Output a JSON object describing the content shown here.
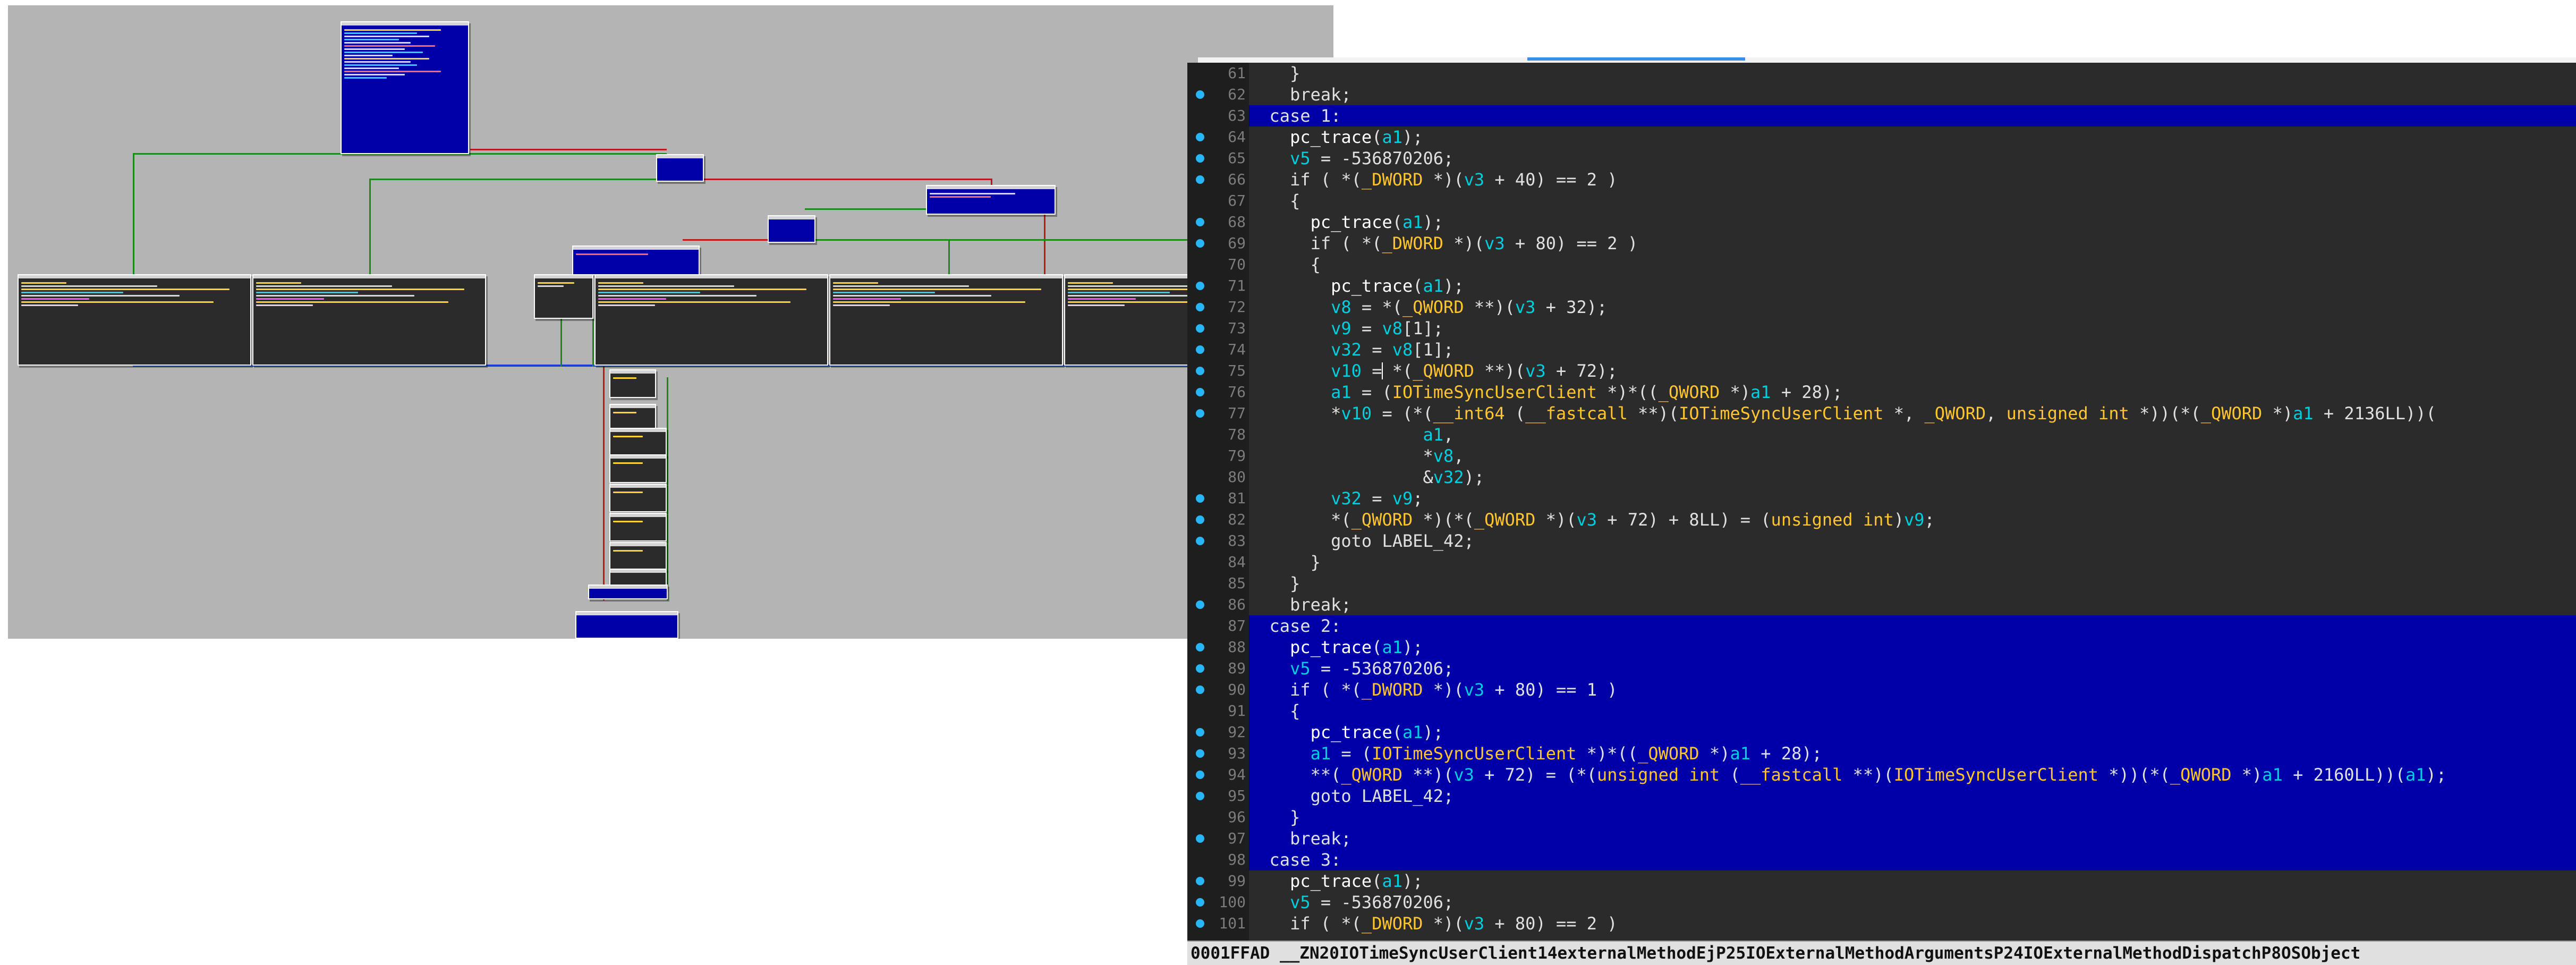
{
  "graph_view": {
    "label": "function-graph-overview"
  },
  "pseudocode": {
    "status_bar_text": "0001FFAD __ZN20IOTimeSyncUserClient14externalMethodEjP25IOExternalMethodArgumentsP24IOExternalMethodDispatchP8OSObject",
    "colors": {
      "highlight": "#0000a8",
      "variable": "#00cfe0",
      "type": "#ffc42e",
      "function": "#ffffff",
      "default": "#d4d4d4",
      "breakpoint_dot": "#29b6f6"
    },
    "lines": [
      {
        "n": "61",
        "dot": false,
        "hl": false,
        "tokens": [
          [
            "d",
            "    }"
          ]
        ]
      },
      {
        "n": "62",
        "dot": true,
        "hl": false,
        "tokens": [
          [
            "d",
            "    break;"
          ]
        ]
      },
      {
        "n": "63",
        "dot": false,
        "hl": true,
        "tokens": [
          [
            "d",
            "  case 1:"
          ]
        ]
      },
      {
        "n": "64",
        "dot": true,
        "hl": false,
        "tokens": [
          [
            "d",
            "    "
          ],
          [
            "f",
            "pc_trace"
          ],
          [
            "d",
            "("
          ],
          [
            "v",
            "a1"
          ],
          [
            "d",
            ");"
          ]
        ]
      },
      {
        "n": "65",
        "dot": true,
        "hl": false,
        "tokens": [
          [
            "d",
            "    "
          ],
          [
            "v",
            "v5"
          ],
          [
            "d",
            " = -536870206;"
          ]
        ]
      },
      {
        "n": "66",
        "dot": true,
        "hl": false,
        "tokens": [
          [
            "d",
            "    if ( *("
          ],
          [
            "t",
            "_DWORD"
          ],
          [
            "d",
            " *)("
          ],
          [
            "v",
            "v3"
          ],
          [
            "d",
            " + 40) == 2 )"
          ]
        ]
      },
      {
        "n": "67",
        "dot": false,
        "hl": false,
        "tokens": [
          [
            "d",
            "    {"
          ]
        ]
      },
      {
        "n": "68",
        "dot": true,
        "hl": false,
        "tokens": [
          [
            "d",
            "      "
          ],
          [
            "f",
            "pc_trace"
          ],
          [
            "d",
            "("
          ],
          [
            "v",
            "a1"
          ],
          [
            "d",
            ");"
          ]
        ]
      },
      {
        "n": "69",
        "dot": true,
        "hl": false,
        "tokens": [
          [
            "d",
            "      if ( *("
          ],
          [
            "t",
            "_DWORD"
          ],
          [
            "d",
            " *)("
          ],
          [
            "v",
            "v3"
          ],
          [
            "d",
            " + 80) == 2 )"
          ]
        ]
      },
      {
        "n": "70",
        "dot": false,
        "hl": false,
        "tokens": [
          [
            "d",
            "      {"
          ]
        ]
      },
      {
        "n": "71",
        "dot": true,
        "hl": false,
        "tokens": [
          [
            "d",
            "        "
          ],
          [
            "f",
            "pc_trace"
          ],
          [
            "d",
            "("
          ],
          [
            "v",
            "a1"
          ],
          [
            "d",
            ");"
          ]
        ]
      },
      {
        "n": "72",
        "dot": true,
        "hl": false,
        "tokens": [
          [
            "d",
            "        "
          ],
          [
            "v",
            "v8"
          ],
          [
            "d",
            " = *("
          ],
          [
            "t",
            "_QWORD"
          ],
          [
            "d",
            " **)("
          ],
          [
            "v",
            "v3"
          ],
          [
            "d",
            " + 32);"
          ]
        ]
      },
      {
        "n": "73",
        "dot": true,
        "hl": false,
        "tokens": [
          [
            "d",
            "        "
          ],
          [
            "v",
            "v9"
          ],
          [
            "d",
            " = "
          ],
          [
            "v",
            "v8"
          ],
          [
            "d",
            "[1];"
          ]
        ]
      },
      {
        "n": "74",
        "dot": true,
        "hl": false,
        "tokens": [
          [
            "d",
            "        "
          ],
          [
            "v",
            "v32"
          ],
          [
            "d",
            " = "
          ],
          [
            "v",
            "v8"
          ],
          [
            "d",
            "[1];"
          ]
        ]
      },
      {
        "n": "75",
        "dot": true,
        "hl": false,
        "tokens": [
          [
            "d",
            "        "
          ],
          [
            "v",
            "v10"
          ],
          [
            "d",
            " = *("
          ],
          [
            "t",
            "_QWORD"
          ],
          [
            "d",
            " **)("
          ],
          [
            "v",
            "v3"
          ],
          [
            "d",
            " + 72);"
          ]
        ]
      },
      {
        "n": "76",
        "dot": true,
        "hl": false,
        "tokens": [
          [
            "d",
            "        "
          ],
          [
            "v",
            "a1"
          ],
          [
            "d",
            " = ("
          ],
          [
            "t",
            "IOTimeSyncUserClient"
          ],
          [
            "d",
            " *)*(("
          ],
          [
            "t",
            "_QWORD"
          ],
          [
            "d",
            " *)"
          ],
          [
            "v",
            "a1"
          ],
          [
            "d",
            " + 28);"
          ]
        ]
      },
      {
        "n": "77",
        "dot": true,
        "hl": false,
        "tokens": [
          [
            "d",
            "        *"
          ],
          [
            "v",
            "v10"
          ],
          [
            "d",
            " = (*("
          ],
          [
            "t",
            "__int64"
          ],
          [
            "d",
            " ("
          ],
          [
            "t",
            "__fastcall"
          ],
          [
            "d",
            " **)("
          ],
          [
            "t",
            "IOTimeSyncUserClient"
          ],
          [
            "d",
            " *, "
          ],
          [
            "t",
            "_QWORD"
          ],
          [
            "d",
            ", "
          ],
          [
            "t",
            "unsigned int"
          ],
          [
            "d",
            " *))(*("
          ],
          [
            "t",
            "_QWORD"
          ],
          [
            "d",
            " *)"
          ],
          [
            "v",
            "a1"
          ],
          [
            "d",
            " + 2136LL))("
          ]
        ]
      },
      {
        "n": "78",
        "dot": false,
        "hl": false,
        "tokens": [
          [
            "d",
            "                 "
          ],
          [
            "v",
            "a1"
          ],
          [
            "d",
            ","
          ]
        ]
      },
      {
        "n": "79",
        "dot": false,
        "hl": false,
        "tokens": [
          [
            "d",
            "                 *"
          ],
          [
            "v",
            "v8"
          ],
          [
            "d",
            ","
          ]
        ]
      },
      {
        "n": "80",
        "dot": false,
        "hl": false,
        "tokens": [
          [
            "d",
            "                 &"
          ],
          [
            "v",
            "v32"
          ],
          [
            "d",
            ");"
          ]
        ]
      },
      {
        "n": "81",
        "dot": true,
        "hl": false,
        "tokens": [
          [
            "d",
            "        "
          ],
          [
            "v",
            "v32"
          ],
          [
            "d",
            " = "
          ],
          [
            "v",
            "v9"
          ],
          [
            "d",
            ";"
          ]
        ]
      },
      {
        "n": "82",
        "dot": true,
        "hl": false,
        "tokens": [
          [
            "d",
            "        *("
          ],
          [
            "t",
            "_QWORD"
          ],
          [
            "d",
            " *)(*("
          ],
          [
            "t",
            "_QWORD"
          ],
          [
            "d",
            " *)("
          ],
          [
            "v",
            "v3"
          ],
          [
            "d",
            " + 72) + 8LL) = ("
          ],
          [
            "t",
            "unsigned int"
          ],
          [
            "d",
            ")"
          ],
          [
            "v",
            "v9"
          ],
          [
            "d",
            ";"
          ]
        ]
      },
      {
        "n": "83",
        "dot": true,
        "hl": false,
        "tokens": [
          [
            "d",
            "        goto LABEL_42;"
          ]
        ]
      },
      {
        "n": "84",
        "dot": false,
        "hl": false,
        "tokens": [
          [
            "d",
            "      }"
          ]
        ]
      },
      {
        "n": "85",
        "dot": false,
        "hl": false,
        "tokens": [
          [
            "d",
            "    }"
          ]
        ]
      },
      {
        "n": "86",
        "dot": true,
        "hl": false,
        "tokens": [
          [
            "d",
            "    break;"
          ]
        ]
      },
      {
        "n": "87",
        "dot": false,
        "hl": true,
        "tokens": [
          [
            "d",
            "  case 2:"
          ]
        ]
      },
      {
        "n": "88",
        "dot": true,
        "hl": true,
        "tokens": [
          [
            "d",
            "    "
          ],
          [
            "f",
            "pc_trace"
          ],
          [
            "d",
            "("
          ],
          [
            "v",
            "a1"
          ],
          [
            "d",
            ");"
          ]
        ]
      },
      {
        "n": "89",
        "dot": true,
        "hl": true,
        "tokens": [
          [
            "d",
            "    "
          ],
          [
            "v",
            "v5"
          ],
          [
            "d",
            " = -536870206;"
          ]
        ]
      },
      {
        "n": "90",
        "dot": true,
        "hl": true,
        "tokens": [
          [
            "d",
            "    if ( *("
          ],
          [
            "t",
            "_DWORD"
          ],
          [
            "d",
            " *)("
          ],
          [
            "v",
            "v3"
          ],
          [
            "d",
            " + 80) == 1 )"
          ]
        ]
      },
      {
        "n": "91",
        "dot": false,
        "hl": true,
        "tokens": [
          [
            "d",
            "    {"
          ]
        ]
      },
      {
        "n": "92",
        "dot": true,
        "hl": true,
        "tokens": [
          [
            "d",
            "      "
          ],
          [
            "f",
            "pc_trace"
          ],
          [
            "d",
            "("
          ],
          [
            "v",
            "a1"
          ],
          [
            "d",
            ");"
          ]
        ]
      },
      {
        "n": "93",
        "dot": true,
        "hl": true,
        "tokens": [
          [
            "d",
            "      "
          ],
          [
            "v",
            "a1"
          ],
          [
            "d",
            " = ("
          ],
          [
            "t",
            "IOTimeSyncUserClient"
          ],
          [
            "d",
            " *)*(("
          ],
          [
            "t",
            "_QWORD"
          ],
          [
            "d",
            " *)"
          ],
          [
            "v",
            "a1"
          ],
          [
            "d",
            " + 28);"
          ]
        ]
      },
      {
        "n": "94",
        "dot": true,
        "hl": true,
        "tokens": [
          [
            "d",
            "      **("
          ],
          [
            "t",
            "_QWORD"
          ],
          [
            "d",
            " **)("
          ],
          [
            "v",
            "v3"
          ],
          [
            "d",
            " + 72) = (*("
          ],
          [
            "t",
            "unsigned int"
          ],
          [
            "d",
            " ("
          ],
          [
            "t",
            "__fastcall"
          ],
          [
            "d",
            " **)("
          ],
          [
            "t",
            "IOTimeSyncUserClient"
          ],
          [
            "d",
            " *))(*("
          ],
          [
            "t",
            "_QWORD"
          ],
          [
            "d",
            " *)"
          ],
          [
            "v",
            "a1"
          ],
          [
            "d",
            " + 2160LL))("
          ],
          [
            "v",
            "a1"
          ],
          [
            "d",
            ");"
          ]
        ]
      },
      {
        "n": "95",
        "dot": true,
        "hl": true,
        "tokens": [
          [
            "d",
            "      goto LABEL_42;"
          ]
        ]
      },
      {
        "n": "96",
        "dot": false,
        "hl": true,
        "tokens": [
          [
            "d",
            "    }"
          ]
        ]
      },
      {
        "n": "97",
        "dot": true,
        "hl": true,
        "tokens": [
          [
            "d",
            "    break;"
          ]
        ]
      },
      {
        "n": "98",
        "dot": false,
        "hl": true,
        "tokens": [
          [
            "d",
            "  case 3:"
          ]
        ]
      },
      {
        "n": "99",
        "dot": true,
        "hl": false,
        "tokens": [
          [
            "d",
            "    "
          ],
          [
            "f",
            "pc_trace"
          ],
          [
            "d",
            "("
          ],
          [
            "v",
            "a1"
          ],
          [
            "d",
            ");"
          ]
        ]
      },
      {
        "n": "100",
        "dot": true,
        "hl": false,
        "tokens": [
          [
            "d",
            "    "
          ],
          [
            "v",
            "v5"
          ],
          [
            "d",
            " = -536870206;"
          ]
        ]
      },
      {
        "n": "101",
        "dot": true,
        "hl": false,
        "tokens": [
          [
            "d",
            "    if ( *("
          ],
          [
            "t",
            "_DWORD"
          ],
          [
            "d",
            " *)("
          ],
          [
            "v",
            "v3"
          ],
          [
            "d",
            " + 80) == 2 )"
          ]
        ]
      }
    ]
  }
}
